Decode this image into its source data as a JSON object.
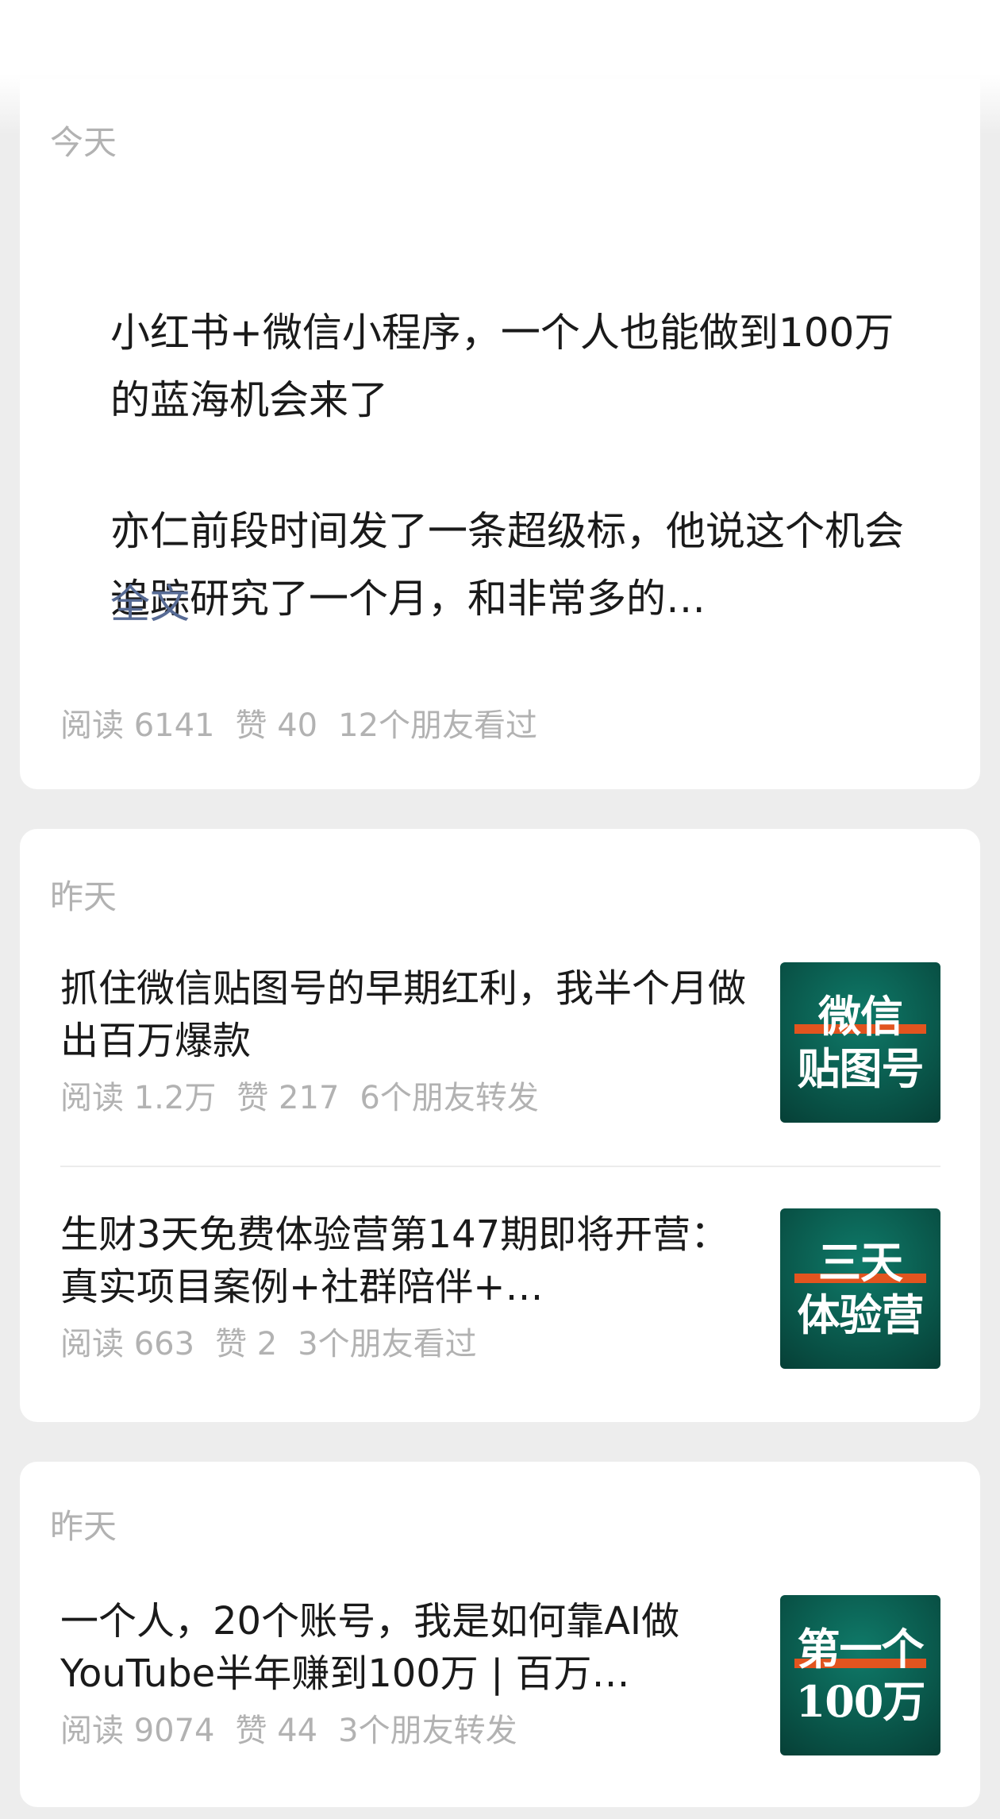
{
  "card1": {
    "date": "今天",
    "message_title": "小红书+微信小程序，一个人也能做到100万的蓝海机会来了",
    "message_body": "亦仁前段时间发了一条超级标，他说这个机会追踪研究了一个月，和非常多的…",
    "full_text_link": "全文",
    "reads": "阅读 6141",
    "likes": "赞 40",
    "friends": "12个朋友看过"
  },
  "card2": {
    "date": "昨天",
    "articles": [
      {
        "title": "抓住微信贴图号的早期红利，我半个月做出百万爆款",
        "reads": "阅读 1.2万",
        "likes": "赞 217",
        "friends": "6个朋友转发",
        "thumb_line1": "微信",
        "thumb_line2": "贴图号"
      },
      {
        "title": "生财3天免费体验营第147期即将开营：真实项目案例+社群陪伴+…",
        "reads": "阅读 663",
        "likes": "赞 2",
        "friends": "3个朋友看过",
        "thumb_line1": "三天",
        "thumb_line2": "体验营"
      }
    ]
  },
  "card3": {
    "date": "昨天",
    "articles": [
      {
        "title": "一个人，20个账号，我是如何靠AI做YouTube半年赚到100万 | 百万…",
        "reads": "阅读 9074",
        "likes": "赞 44",
        "friends": "3个朋友转发",
        "thumb_line1": "第一个",
        "thumb_line2": "100万"
      }
    ]
  },
  "colors": {
    "background": "#ededed",
    "card": "#ffffff",
    "link": "#576b95",
    "meta_text": "#b2b2b2",
    "thumb_green": "#0a5a4d",
    "thumb_accent": "#e2541f"
  }
}
